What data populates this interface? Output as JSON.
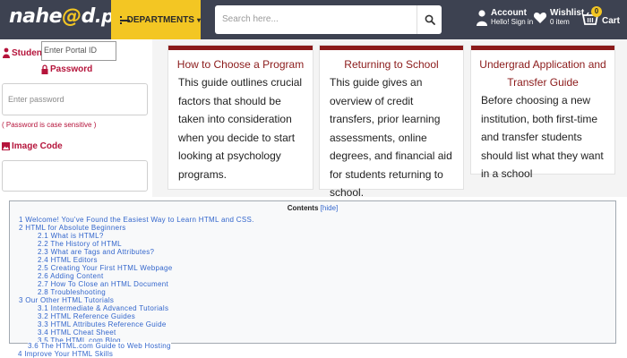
{
  "header": {
    "logo_main": "nahe",
    "logo_ring": "@",
    "logo_rest": "d",
    "logo_tld": ".pk",
    "departments_label": "DEPARTMENTS",
    "search_placeholder": "Search here...",
    "account_title": "Account",
    "account_sub": "Hello! Sign in",
    "wishlist_title": "Wishlist",
    "wishlist_sub": "0 item",
    "cart_label": "Cart",
    "cart_count": "0",
    "colors": {
      "bar": "#3d4251",
      "accent": "#f3c623"
    }
  },
  "login": {
    "student_id_label": "Student ID",
    "portal_id_placeholder": "Enter Portal ID",
    "password_label": "Password",
    "password_placeholder": "Enter password",
    "case_note": "( Password is case sensitive )",
    "image_code_label": "Image Code",
    "label_color": "#b5143b"
  },
  "cards": [
    {
      "title": "How to Choose a Program",
      "body": "This guide outlines crucial factors that should be taken into consideration when you decide to start looking at psychology programs."
    },
    {
      "title": "Returning to School",
      "body": "This guide gives an overview of credit transfers, prior learning assessments, online degrees, and financial aid for students returning to school."
    },
    {
      "title": "Undergrad Application and Transfer Guide",
      "body": "Before choosing a new institution, both first-time and transfer students should list what they want in a school"
    }
  ],
  "toc": {
    "title": "Contents",
    "hide_label": "hide",
    "items": [
      {
        "num": "1",
        "text": "Welcome! You've Found the Easiest Way to Learn HTML and CSS."
      },
      {
        "num": "2",
        "text": "HTML for Absolute Beginners"
      },
      {
        "num": "2.1",
        "text": "What is HTML?"
      },
      {
        "num": "2.2",
        "text": "The History of HTML"
      },
      {
        "num": "2.3",
        "text": "What are Tags and Attributes?"
      },
      {
        "num": "2.4",
        "text": "HTML Editors"
      },
      {
        "num": "2.5",
        "text": "Creating Your First HTML Webpage"
      },
      {
        "num": "2.6",
        "text": "Adding Content"
      },
      {
        "num": "2.7",
        "text": "How To Close an HTML Document"
      },
      {
        "num": "2.8",
        "text": "Troubleshooting"
      },
      {
        "num": "3",
        "text": "Our Other HTML Tutorials"
      },
      {
        "num": "3.1",
        "text": "Intermediate & Advanced Tutorials"
      },
      {
        "num": "3.2",
        "text": "HTML Reference Guides"
      },
      {
        "num": "3.3",
        "text": "HTML Attributes Reference Guide"
      },
      {
        "num": "3.4",
        "text": "HTML Cheat Sheet"
      },
      {
        "num": "3.5",
        "text": "The HTML.com Blog"
      },
      {
        "num": "3.6",
        "text": "The HTML.com Guide to Web Hosting"
      },
      {
        "num": "4",
        "text": "Improve Your HTML Skills"
      }
    ]
  }
}
